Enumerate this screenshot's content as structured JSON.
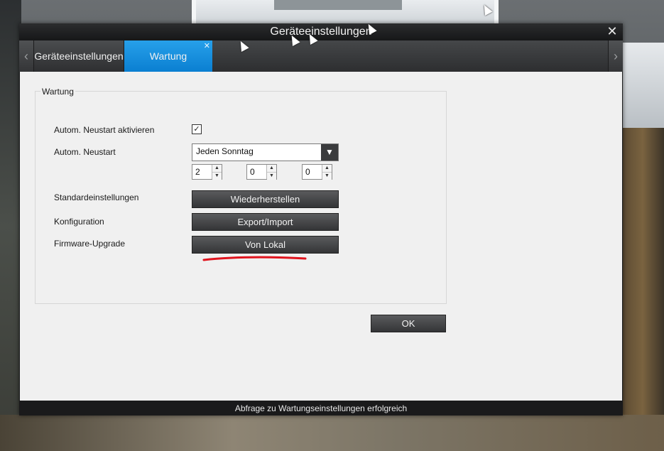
{
  "window": {
    "title": "Geräteeinstellungen",
    "close_icon": "close-icon"
  },
  "tabs": [
    {
      "label": "Geräteeinstellungen",
      "active": false
    },
    {
      "label": "Wartung",
      "active": true
    }
  ],
  "tab_nav": {
    "prev_icon": "chevron-left-icon",
    "next_icon": "chevron-right-icon"
  },
  "group": {
    "title": "Wartung"
  },
  "rows": {
    "auto_restart_enable": {
      "label": "Autom. Neustart aktivieren",
      "checked": true
    },
    "auto_restart": {
      "label": "Autom. Neustart",
      "schedule_value": "Jeden Sonntag",
      "hour": "2",
      "minute": "0",
      "second": "0"
    },
    "defaults": {
      "label": "Standardeinstellungen",
      "button": "Wiederherstellen"
    },
    "config": {
      "label": "Konfiguration",
      "button": "Export/Import"
    },
    "firmware": {
      "label": "Firmware-Upgrade",
      "button": "Von Lokal"
    }
  },
  "ok_button": "OK",
  "status": "Abfrage zu Wartungseinstellungen erfolgreich",
  "colors": {
    "accent_tab": "#0a7fd1",
    "annotation_underline": "#e0141e"
  }
}
